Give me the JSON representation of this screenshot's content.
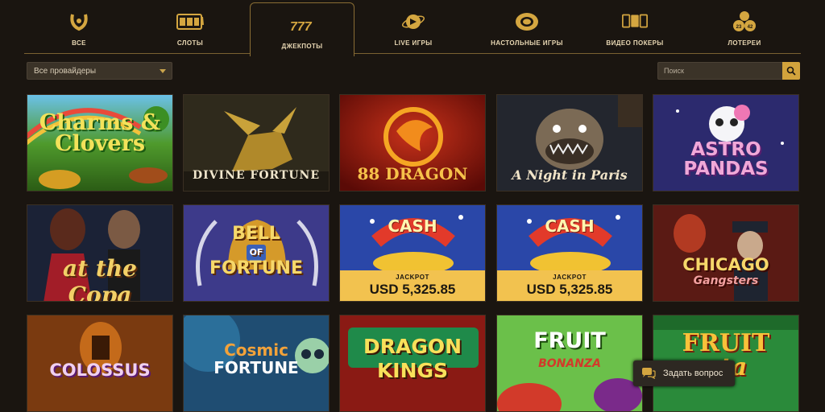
{
  "tabs": [
    {
      "label": "ВСЕ",
      "icon": "horseshoe-icon"
    },
    {
      "label": "СЛОТЫ",
      "icon": "slot-machine-icon"
    },
    {
      "label": "ДЖЕКПОТЫ",
      "icon": "lucky-777-icon",
      "active": true
    },
    {
      "label": "LIVE ИГРЫ",
      "icon": "globe-live-icon"
    },
    {
      "label": "НАСТОЛЬНЫЕ ИГРЫ",
      "icon": "poker-chip-icon"
    },
    {
      "label": "ВИДЕО ПОКЕРЫ",
      "icon": "cards-icon"
    },
    {
      "label": "ЛОТЕРЕИ",
      "icon": "lottery-balls-icon"
    }
  ],
  "lottery_numbers": [
    "23",
    "42"
  ],
  "filters": {
    "provider_selected": "Все провайдеры"
  },
  "search": {
    "placeholder": "Поиск"
  },
  "games": [
    {
      "title_lines": [
        "Charms &",
        "Clovers"
      ]
    },
    {
      "title_lines": [
        "DIVINE FORTUNE"
      ]
    },
    {
      "title_lines": [
        "88 DRAGON"
      ]
    },
    {
      "title_lines": [
        "A Night in Paris"
      ]
    },
    {
      "title_lines": [
        "ASTRO",
        "PANDAS"
      ]
    },
    {
      "title_lines": [
        "at the Copa"
      ]
    },
    {
      "title_lines": [
        "BELL",
        "OF",
        "FORTUNE"
      ]
    },
    {
      "title_lines": [
        "CASH"
      ],
      "jackpot_label": "JACKPOT",
      "jackpot_value": "USD 5,325.85"
    },
    {
      "title_lines": [
        "CASH"
      ],
      "jackpot_label": "JACKPOT",
      "jackpot_value": "USD 5,325.85"
    },
    {
      "title_lines": [
        "CHICAGO",
        "Gangsters"
      ]
    },
    {
      "title_lines": [
        "COLOSSUS"
      ]
    },
    {
      "title_lines": [
        "Cosmic",
        "FORTUNE"
      ]
    },
    {
      "title_lines": [
        "DRAGON",
        "KINGS"
      ]
    },
    {
      "title_lines": [
        "FRUIT",
        "BONANZA"
      ]
    },
    {
      "title_lines": [
        "FRUIT",
        "ata"
      ]
    }
  ],
  "chat": {
    "label": "Задать вопрос"
  }
}
